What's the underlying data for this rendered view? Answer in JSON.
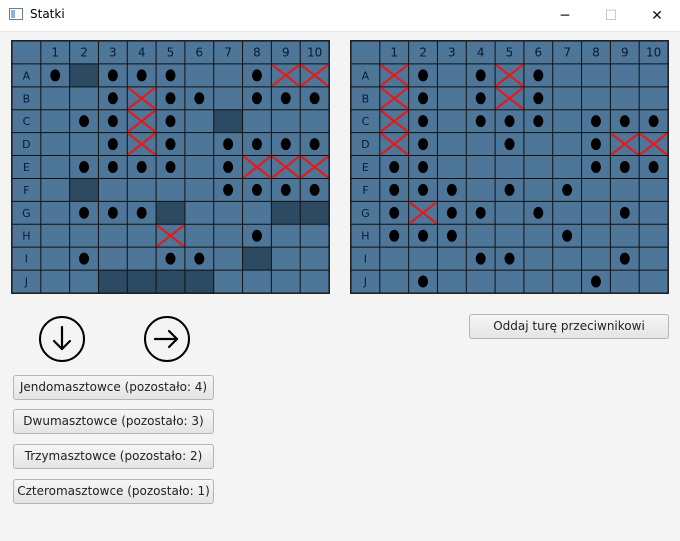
{
  "window": {
    "title": "Statki",
    "icon": "app-window-icon",
    "minimize_label": "─",
    "maximize_label": "☐",
    "close_label": "✕"
  },
  "colors": {
    "water": "#4e7699",
    "ship": "#2d4a63",
    "grid_line": "#111111",
    "hit_mark": "#e21b1b",
    "miss_mark": "#000000",
    "header_text": "#0a1a33"
  },
  "boards": [
    {
      "name": "player-board",
      "columns": [
        "1",
        "2",
        "3",
        "4",
        "5",
        "6",
        "7",
        "8",
        "9",
        "10"
      ],
      "rows": [
        "A",
        "B",
        "C",
        "D",
        "E",
        "F",
        "G",
        "H",
        "I",
        "J"
      ],
      "ships": [
        "A2",
        "C7",
        "F2",
        "G5",
        "G9",
        "G10",
        "I8",
        "J3",
        "J4",
        "J5",
        "J6"
      ],
      "hits": [
        "A9",
        "A10",
        "B4",
        "C4",
        "D4",
        "E8",
        "E9",
        "E10",
        "H5"
      ],
      "misses": [
        "A1",
        "A3",
        "A4",
        "A5",
        "A8",
        "B3",
        "B5",
        "B6",
        "B8",
        "B9",
        "B10",
        "C2",
        "C3",
        "C5",
        "D3",
        "D5",
        "D7",
        "D8",
        "D9",
        "D10",
        "E2",
        "E3",
        "E4",
        "E5",
        "E7",
        "F7",
        "F8",
        "F9",
        "F10",
        "G2",
        "G3",
        "G4",
        "H8",
        "I2",
        "I5",
        "I6"
      ]
    },
    {
      "name": "opponent-board",
      "columns": [
        "1",
        "2",
        "3",
        "4",
        "5",
        "6",
        "7",
        "8",
        "9",
        "10"
      ],
      "rows": [
        "A",
        "B",
        "C",
        "D",
        "E",
        "F",
        "G",
        "H",
        "I",
        "J"
      ],
      "ships": [],
      "hits": [
        "A1",
        "A5",
        "B1",
        "B5",
        "C1",
        "D1",
        "D9",
        "D10",
        "G2"
      ],
      "misses": [
        "A2",
        "A4",
        "A6",
        "B2",
        "B4",
        "B6",
        "C2",
        "C4",
        "C5",
        "C6",
        "C8",
        "C9",
        "C10",
        "D2",
        "D5",
        "D8",
        "E1",
        "E2",
        "E8",
        "E9",
        "E10",
        "F1",
        "F2",
        "F3",
        "F5",
        "F7",
        "G1",
        "G3",
        "G4",
        "G6",
        "G9",
        "H1",
        "H2",
        "H3",
        "H7",
        "I4",
        "I5",
        "I9",
        "J2",
        "J8"
      ]
    }
  ],
  "controls": {
    "orientation_down": "arrow-down-icon",
    "orientation_right": "arrow-right-icon",
    "end_turn_label": "Oddaj turę przeciwnikowi",
    "ship_buttons": [
      "Jendomasztowce (pozostało: 4)",
      "Dwumasztowce (pozostało: 3)",
      "Trzymasztowce (pozostało: 2)",
      "Czteromasztowce (pozostało: 1)"
    ]
  }
}
